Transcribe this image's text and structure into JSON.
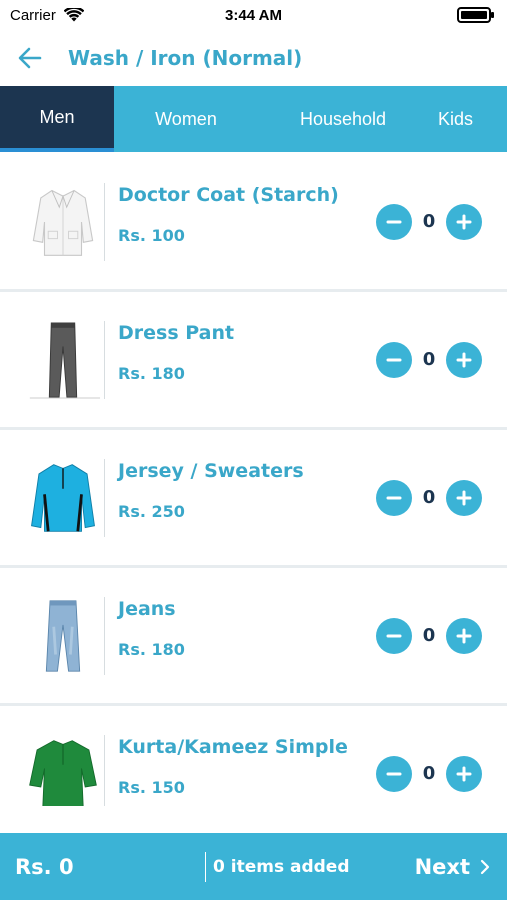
{
  "status_bar": {
    "carrier": "Carrier",
    "time": "3:44 AM"
  },
  "header": {
    "title": "Wash / Iron (Normal)",
    "back_icon": "arrow-left-icon"
  },
  "tabs": [
    {
      "label": "Men",
      "active": true
    },
    {
      "label": "Women",
      "active": false
    },
    {
      "label": "Household",
      "active": false
    },
    {
      "label": "Kids",
      "active": false
    }
  ],
  "items": [
    {
      "name": "Doctor Coat (Starch)",
      "price": "Rs. 100",
      "qty": "0",
      "image": "white-coat-image"
    },
    {
      "name": "Dress Pant",
      "price": "Rs. 180",
      "qty": "0",
      "image": "gray-pant-image"
    },
    {
      "name": "Jersey / Sweaters",
      "price": "Rs. 250",
      "qty": "0",
      "image": "blue-jersey-image"
    },
    {
      "name": "Jeans",
      "price": "Rs. 180",
      "qty": "0",
      "image": "blue-jeans-image"
    },
    {
      "name": "Kurta/Kameez Simple",
      "price": "Rs. 150",
      "qty": "0",
      "image": "green-kurta-image"
    }
  ],
  "footer": {
    "total": "Rs. 0",
    "items_added": "0 items added",
    "next_label": "Next"
  },
  "colors": {
    "accent": "#3bb3d6",
    "dark_navy": "#1c3550",
    "text_accent": "#3aa7c9",
    "list_bg": "#e7ecef"
  }
}
